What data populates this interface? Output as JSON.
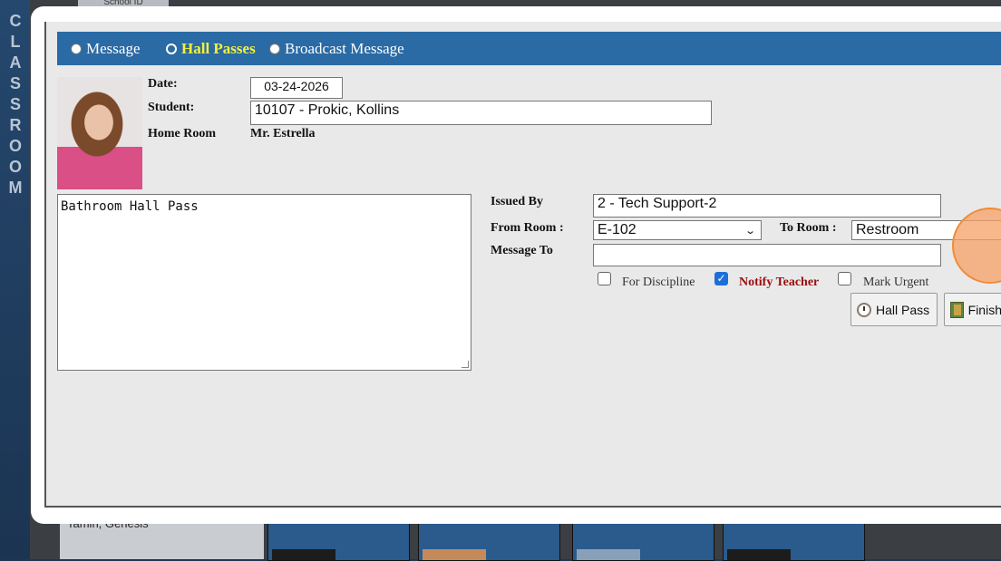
{
  "background": {
    "sidebar_letters": [
      "C",
      "L",
      "A",
      "S",
      "S",
      "R",
      "O",
      "O",
      "M"
    ],
    "top_tab": "School ID",
    "list_item": "Tamin, Genesis"
  },
  "modal": {
    "mode_options": [
      "Message",
      "Hall Passes",
      "Broadcast Message"
    ],
    "selected_mode": "Hall Passes",
    "labels": {
      "date": "Date:",
      "student": "Student:",
      "home_room": "Home Room",
      "issued_by": "Issued By",
      "from_room": "From Room :",
      "to_room": "To Room :",
      "message_to": "Message To"
    },
    "values": {
      "date": "03-24-2026",
      "student": "10107 - Prokic, Kollins",
      "home_room": "Mr. Estrella",
      "issued_by": "2 - Tech Support-2",
      "from_room": "E-102",
      "to_room": "Restroom",
      "message_to": "",
      "message_body": "Bathroom Hall Pass"
    },
    "checkboxes": [
      {
        "label": "For Discipline",
        "checked": false
      },
      {
        "label": "Notify Teacher",
        "checked": true
      },
      {
        "label": "Mark Urgent",
        "checked": false
      }
    ],
    "buttons": {
      "hall_pass": "Hall Pass",
      "finish": "Finish"
    }
  },
  "colors": {
    "header": "#2a6aa5",
    "selected_mode": "#f5f03a",
    "notify_teacher": "#9a0d0d"
  }
}
